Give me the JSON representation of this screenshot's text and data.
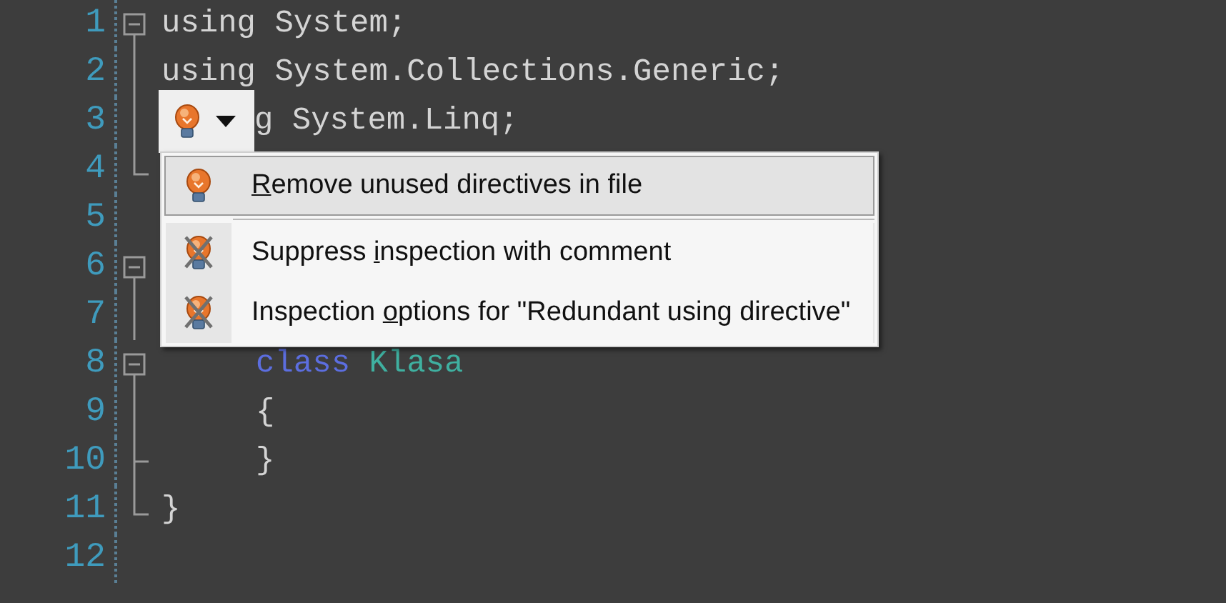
{
  "editor": {
    "lines": [
      {
        "number": "1",
        "kind": "fold-start",
        "lightbulb": false,
        "code": [
          {
            "kind": "plain",
            "text": "using System;"
          }
        ]
      },
      {
        "number": "2",
        "kind": "fold-line",
        "lightbulb": false,
        "code": [
          {
            "kind": "plain",
            "text": "using System.Collections.Generic;"
          }
        ]
      },
      {
        "number": "3",
        "kind": "fold-line",
        "lightbulb": true,
        "code": [
          {
            "kind": "plain",
            "text": "g System.Linq;"
          }
        ]
      },
      {
        "number": "4",
        "kind": "fold-end",
        "lightbulb": false
      },
      {
        "number": "5",
        "kind": "plain",
        "lightbulb": false
      },
      {
        "number": "6",
        "kind": "fold-start",
        "lightbulb": false
      },
      {
        "number": "7",
        "kind": "fold-line",
        "lightbulb": false
      },
      {
        "number": "8",
        "kind": "fold-start",
        "lightbulb": false,
        "code": [
          {
            "kind": "keyword",
            "text": "     class"
          },
          {
            "kind": "type",
            "text": " Klasa"
          }
        ]
      },
      {
        "number": "9",
        "kind": "fold-line",
        "lightbulb": false,
        "code": [
          {
            "kind": "plain",
            "text": "     {"
          }
        ]
      },
      {
        "number": "10",
        "kind": "fold-tick",
        "lightbulb": false,
        "code": [
          {
            "kind": "plain",
            "text": "     }"
          }
        ]
      },
      {
        "number": "11",
        "kind": "fold-end",
        "lightbulb": false,
        "code": [
          {
            "kind": "plain",
            "text": "}"
          }
        ]
      },
      {
        "number": "12",
        "kind": "plain",
        "lightbulb": false
      }
    ]
  },
  "quick_fix_menu": {
    "groups": [
      [
        {
          "kind": "fix",
          "mnemonic": "R",
          "text_after": "emove unused directives in file",
          "selected": true
        }
      ],
      [
        {
          "kind": "inspection",
          "text_before": "Suppress ",
          "mnemonic": "i",
          "text_after": "nspection with comment",
          "selected": false
        },
        {
          "kind": "inspection",
          "text_before": "Inspection ",
          "mnemonic": "o",
          "text_after": "ptions for \"Redundant using directive\"",
          "selected": false
        }
      ]
    ]
  }
}
